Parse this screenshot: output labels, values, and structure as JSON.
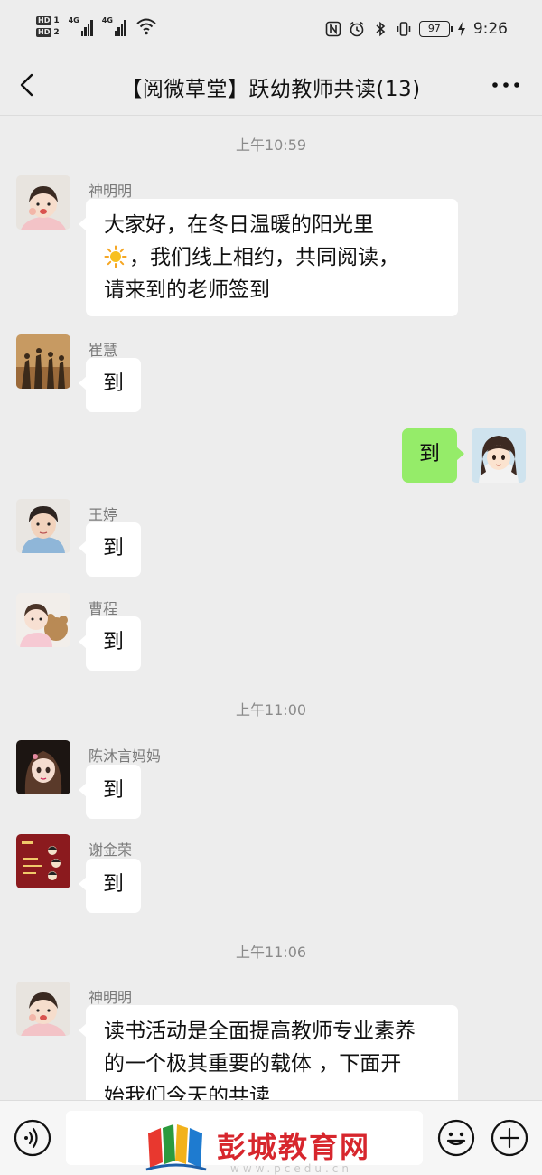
{
  "status_bar": {
    "hd1": "HD",
    "hd1_num": "1",
    "hd2": "HD",
    "hd2_num": "2",
    "net1": "4G",
    "net2": "4G",
    "battery": "97",
    "time": "9:26",
    "icons": [
      "nfc-icon",
      "alarm-icon",
      "bluetooth-icon",
      "vibrate-icon",
      "battery-icon",
      "charging-icon"
    ]
  },
  "header": {
    "title": "【阅微草堂】跃幼教师共读(13)",
    "back_icon": "chevron-left-icon",
    "more_icon": "more-dots-icon"
  },
  "messages": {
    "ts1": "上午10:59",
    "m1": {
      "sender": "神明明",
      "line1": "大家好，在冬日温暖的阳光里",
      "line2": "，我们线上相约，共同阅读，",
      "line3": "请来到的老师签到"
    },
    "m2": {
      "sender": "崔慧",
      "text": "到"
    },
    "m3": {
      "text": "到"
    },
    "m4": {
      "sender": "王婷",
      "text": "到"
    },
    "m5": {
      "sender": "曹程",
      "text": "到"
    },
    "ts2": "上午11:00",
    "m6": {
      "sender": "陈沐言妈妈",
      "text": "到"
    },
    "m7": {
      "sender": "谢金荣",
      "text": "到"
    },
    "ts3": "上午11:06",
    "m8": {
      "sender": "神明明",
      "line1": "读书活动是全面提高教师专业素养",
      "line2": "的一个极其重要的载体 ，下面开",
      "line3": "始我们今天的共读"
    }
  },
  "input_bar": {
    "voice_icon": "voice-icon",
    "emoji_icon": "emoji-icon",
    "plus_icon": "plus-icon"
  },
  "watermark": {
    "text": "彭城教育网",
    "url": "www.pcedu.cn"
  },
  "colors": {
    "background": "#ededed",
    "bubble_self": "#95ec69",
    "bubble_other": "#ffffff",
    "watermark": "#d7262d"
  }
}
